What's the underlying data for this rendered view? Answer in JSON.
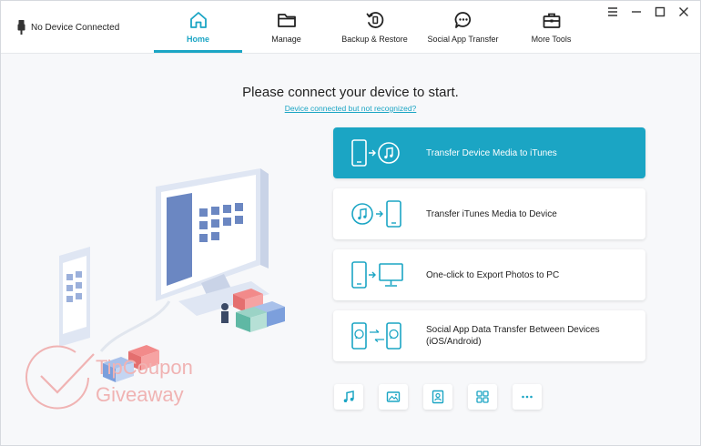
{
  "status": {
    "device": "No Device Connected"
  },
  "nav": {
    "tabs": [
      {
        "label": "Home",
        "icon": "home-icon",
        "active": true
      },
      {
        "label": "Manage",
        "icon": "folder-icon",
        "active": false
      },
      {
        "label": "Backup & Restore",
        "icon": "backup-icon",
        "active": false
      },
      {
        "label": "Social App Transfer",
        "icon": "chat-icon",
        "active": false
      },
      {
        "label": "More Tools",
        "icon": "toolbox-icon",
        "active": false
      }
    ]
  },
  "window_controls": [
    "menu-icon",
    "minimize-icon",
    "maximize-icon",
    "close-icon"
  ],
  "main": {
    "headline": "Please connect your device to start.",
    "help_link": "Device connected but not recognized?"
  },
  "cards": [
    {
      "label": "Transfer Device Media to iTunes",
      "icon": "phone-to-itunes-icon",
      "active": true
    },
    {
      "label": "Transfer iTunes Media to Device",
      "icon": "itunes-to-phone-icon",
      "active": false
    },
    {
      "label": "One-click to Export Photos to PC",
      "icon": "phone-to-pc-icon",
      "active": false
    },
    {
      "label": "Social App Data Transfer Between Devices (iOS/Android)",
      "icon": "whatsapp-transfer-icon",
      "active": false
    }
  ],
  "quick_tools": [
    "music-icon",
    "photo-icon",
    "contacts-icon",
    "apps-icon",
    "more-icon"
  ],
  "watermark": {
    "line1": "TipCoupon",
    "line2": "Giveaway"
  },
  "colors": {
    "accent": "#1ba5c4",
    "background": "#f7f8fa",
    "watermark": "#f0b3b3"
  }
}
